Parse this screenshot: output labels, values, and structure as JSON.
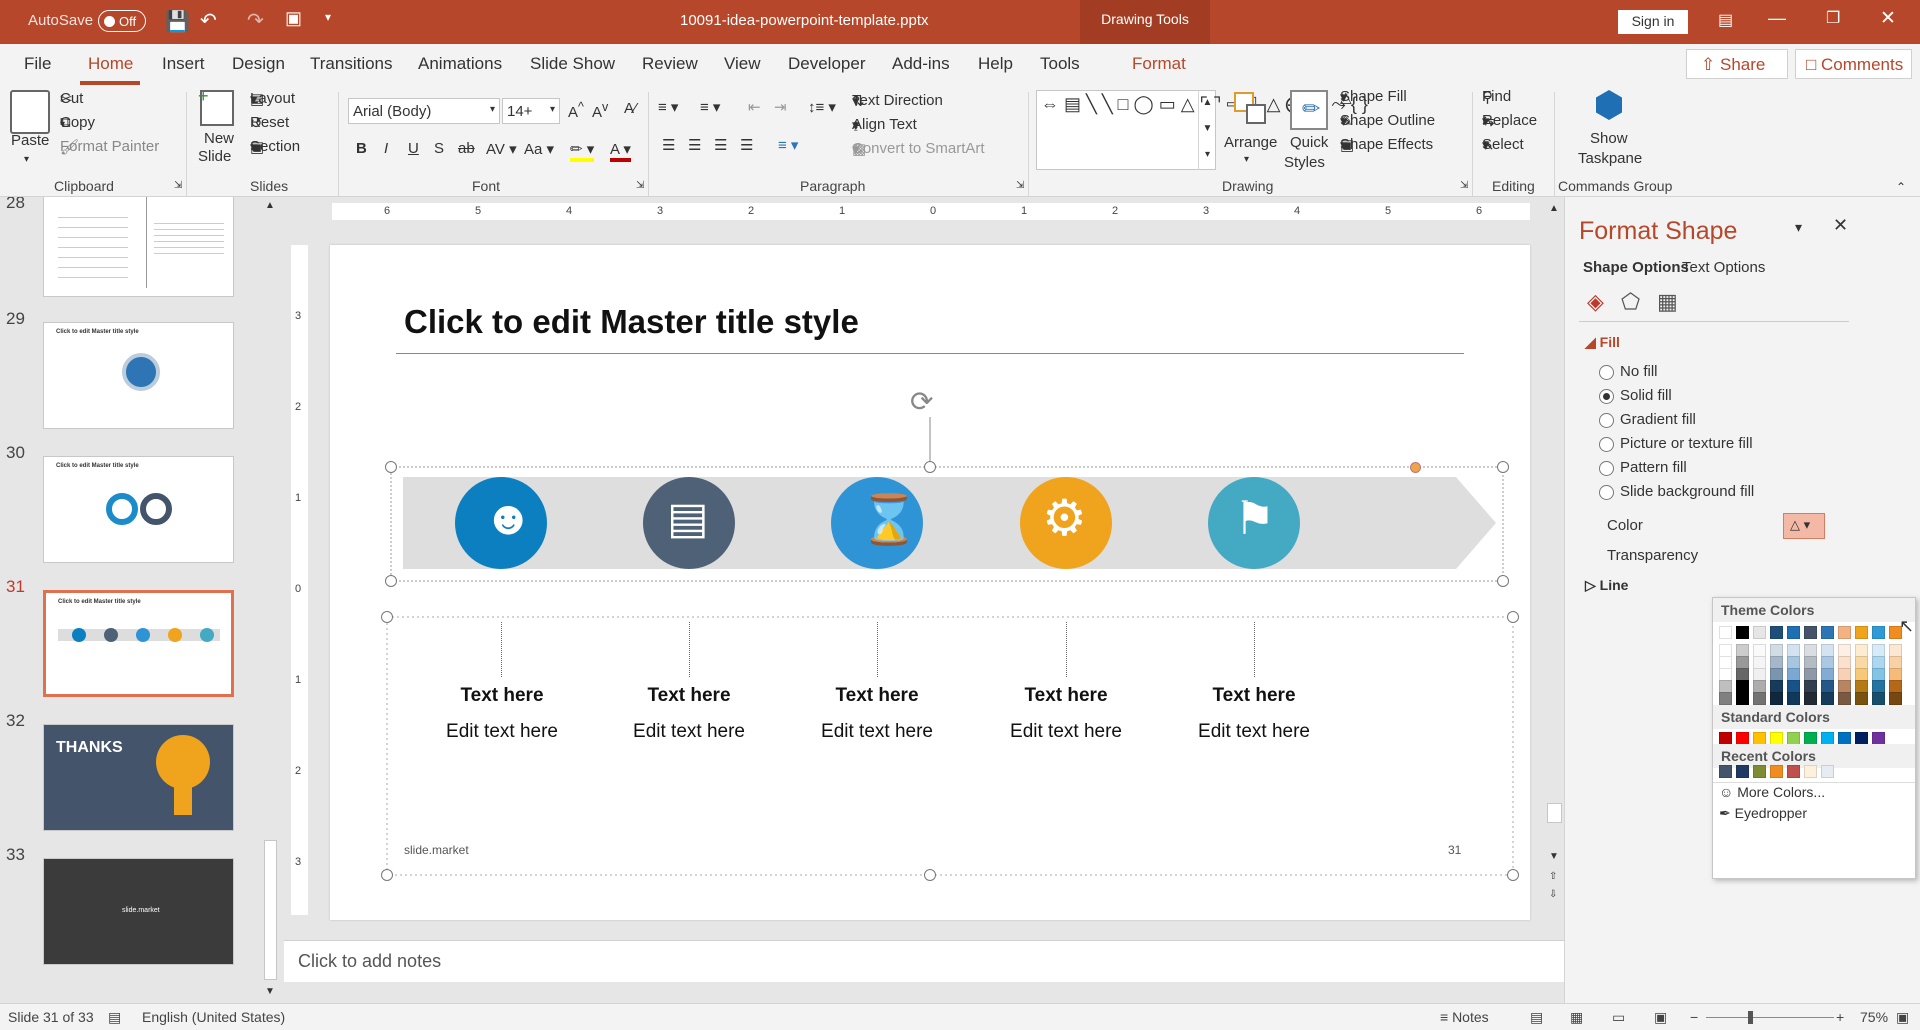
{
  "titlebar": {
    "autosave_label": "AutoSave",
    "autosave_state": "Off",
    "filename": "10091-idea-powerpoint-template.pptx",
    "context": "Drawing Tools",
    "sign_in": "Sign in"
  },
  "tabs": [
    "File",
    "Home",
    "Insert",
    "Design",
    "Transitions",
    "Animations",
    "Slide Show",
    "Review",
    "View",
    "Developer",
    "Add-ins",
    "Help",
    "Tools",
    "Format"
  ],
  "active_tab": "Home",
  "share": "Share",
  "comments": "Comments",
  "ribbon": {
    "clipboard": {
      "paste": "Paste",
      "cut": "Cut",
      "copy": "Copy",
      "format_painter": "Format Painter",
      "group": "Clipboard"
    },
    "slides": {
      "new_slide_1": "New",
      "new_slide_2": "Slide",
      "layout": "Layout",
      "reset": "Reset",
      "section": "Section",
      "group": "Slides"
    },
    "font": {
      "name": "Arial (Body)",
      "size": "14+",
      "group": "Font"
    },
    "paragraph": {
      "text_direction": "Text Direction",
      "align_text": "Align Text",
      "convert": "Convert to SmartArt",
      "group": "Paragraph"
    },
    "drawing": {
      "arrange": "Arrange",
      "quick_styles_1": "Quick",
      "quick_styles_2": "Styles",
      "shape_fill": "Shape Fill",
      "shape_outline": "Shape Outline",
      "shape_effects": "Shape Effects",
      "group": "Drawing"
    },
    "editing": {
      "find": "Find",
      "replace": "Replace",
      "select": "Select",
      "group": "Editing"
    },
    "commands": {
      "show_taskpane_1": "Show",
      "show_taskpane_2": "Taskpane",
      "group": "Commands Group"
    }
  },
  "thumbnails": [
    {
      "num": "28",
      "title": ""
    },
    {
      "num": "29",
      "title": "Click to edit Master title style"
    },
    {
      "num": "30",
      "title": "Click to edit Master title style"
    },
    {
      "num": "31",
      "title": "Click to edit Master title style"
    },
    {
      "num": "32",
      "title": "THANKS"
    },
    {
      "num": "33",
      "title": "slide.market"
    }
  ],
  "ruler_h": [
    "6",
    "5",
    "4",
    "3",
    "2",
    "1",
    "0",
    "1",
    "2",
    "3",
    "4",
    "5",
    "6"
  ],
  "ruler_v": [
    "3",
    "2",
    "1",
    "0",
    "1",
    "2",
    "3"
  ],
  "slide": {
    "title": "Click to edit Master title style",
    "footer": "slide.market",
    "page": "31",
    "items": [
      {
        "heading": "Text here",
        "body": "Edit text here",
        "color": "#0b7fbf",
        "icon": "person-icon"
      },
      {
        "heading": "Text here",
        "body": "Edit text here",
        "color": "#4e6177",
        "icon": "chart-icon"
      },
      {
        "heading": "Text here",
        "body": "Edit text here",
        "color": "#2e94d6",
        "icon": "hourglass-icon"
      },
      {
        "heading": "Text here",
        "body": "Edit text here",
        "color": "#f0a31c",
        "icon": "gear-icon"
      },
      {
        "heading": "Text here",
        "body": "Edit text here",
        "color": "#44a9c2",
        "icon": "flag-icon"
      }
    ]
  },
  "notes_placeholder": "Click to add notes",
  "panel": {
    "title": "Format Shape",
    "tab_shape": "Shape Options",
    "tab_text": "Text Options",
    "fill": "Fill",
    "options": [
      "No fill",
      "Solid fill",
      "Gradient fill",
      "Picture or texture fill",
      "Pattern fill",
      "Slide background fill"
    ],
    "selected": "Solid fill",
    "color_label": "Color",
    "transparency_label": "Transparency",
    "line": "Line"
  },
  "popup": {
    "theme": "Theme Colors",
    "standard": "Standard Colors",
    "recent": "Recent Colors",
    "more": "More Colors...",
    "eyedropper": "Eyedropper",
    "theme_top": [
      "#ffffff",
      "#000000",
      "#e7e6e6",
      "#1f4e79",
      "#1f6fb5",
      "#44546a",
      "#2e75b6",
      "#f4b183",
      "#f0a31c",
      "#2e9bd6",
      "#f08c20"
    ],
    "standard_colors": [
      "#c00000",
      "#ff0000",
      "#ffc000",
      "#ffff00",
      "#92d050",
      "#00b050",
      "#00b0f0",
      "#0070c0",
      "#002060",
      "#7030a0"
    ],
    "recent_colors": [
      "#44546a",
      "#1f3864",
      "#7f8b32",
      "#f08c20",
      "#c0504d",
      "#fdf1dc",
      "#e7ecf3"
    ]
  },
  "status": {
    "slide": "Slide 31 of 33",
    "language": "English (United States)",
    "notes": "Notes",
    "zoom": "75%"
  }
}
